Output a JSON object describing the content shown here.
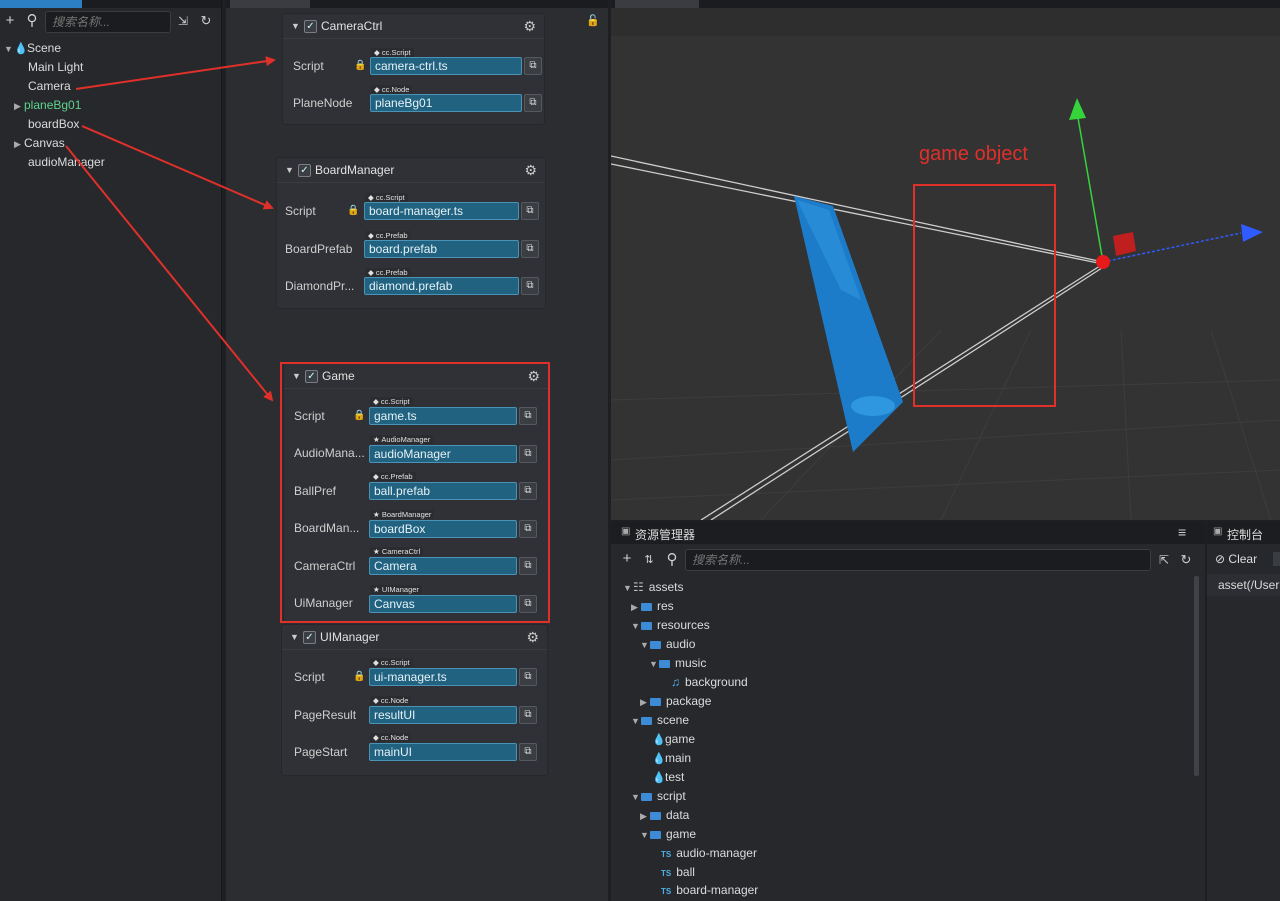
{
  "hierarchy": {
    "search_placeholder": "搜索名称...",
    "items": [
      {
        "label": "Scene"
      },
      {
        "label": "Main Light"
      },
      {
        "label": "Camera"
      },
      {
        "label": "planeBg01"
      },
      {
        "label": "boardBox"
      },
      {
        "label": "Canvas"
      },
      {
        "label": "audioManager"
      }
    ]
  },
  "inspector": {
    "camera_ctrl": {
      "title": "CameraCtrl",
      "props": [
        {
          "label": "Script",
          "tag": "cc.Script",
          "value": "camera-ctrl.ts"
        },
        {
          "label": "PlaneNode",
          "tag": "cc.Node",
          "value": "planeBg01"
        }
      ]
    },
    "board_manager": {
      "title": "BoardManager",
      "props": [
        {
          "label": "Script",
          "tag": "cc.Script",
          "value": "board-manager.ts"
        },
        {
          "label": "BoardPrefab",
          "tag": "cc.Prefab",
          "value": "board.prefab"
        },
        {
          "label": "DiamondPr...",
          "tag": "cc.Prefab",
          "value": "diamond.prefab"
        }
      ]
    },
    "game": {
      "title": "Game",
      "props": [
        {
          "label": "Script",
          "tag": "cc.Script",
          "value": "game.ts"
        },
        {
          "label": "AudioMana...",
          "tag": "AudioManager",
          "value": "audioManager"
        },
        {
          "label": "BallPref",
          "tag": "cc.Prefab",
          "value": "ball.prefab"
        },
        {
          "label": "BoardMan...",
          "tag": "BoardManager",
          "value": "boardBox"
        },
        {
          "label": "CameraCtrl",
          "tag": "CameraCtrl",
          "value": "Camera"
        },
        {
          "label": "UiManager",
          "tag": "UIManager",
          "value": "Canvas"
        }
      ]
    },
    "ui_manager": {
      "title": "UIManager",
      "props": [
        {
          "label": "Script",
          "tag": "cc.Script",
          "value": "ui-manager.ts"
        },
        {
          "label": "PageResult",
          "tag": "cc.Node",
          "value": "resultUI"
        },
        {
          "label": "PageStart",
          "tag": "cc.Node",
          "value": "mainUI"
        }
      ]
    }
  },
  "scene": {
    "annotation": "game object"
  },
  "assets": {
    "title": "资源管理器",
    "search_placeholder": "搜索名称...",
    "items": [
      {
        "label": "assets"
      },
      {
        "label": "res"
      },
      {
        "label": "resources"
      },
      {
        "label": "audio"
      },
      {
        "label": "music"
      },
      {
        "label": "background"
      },
      {
        "label": "package"
      },
      {
        "label": "scene"
      },
      {
        "label": "game"
      },
      {
        "label": "main"
      },
      {
        "label": "test"
      },
      {
        "label": "script"
      },
      {
        "label": "data"
      },
      {
        "label": "game"
      },
      {
        "label": "audio-manager"
      },
      {
        "label": "ball"
      },
      {
        "label": "board-manager"
      }
    ]
  },
  "console": {
    "title": "控制台",
    "clear_label": "Clear",
    "line": "asset(/User"
  },
  "colors": {
    "accent_blue": "#2b7fc2",
    "field_blue": "#20627f",
    "annotation_red": "#e0302a",
    "tree_green": "#5fd38c"
  }
}
